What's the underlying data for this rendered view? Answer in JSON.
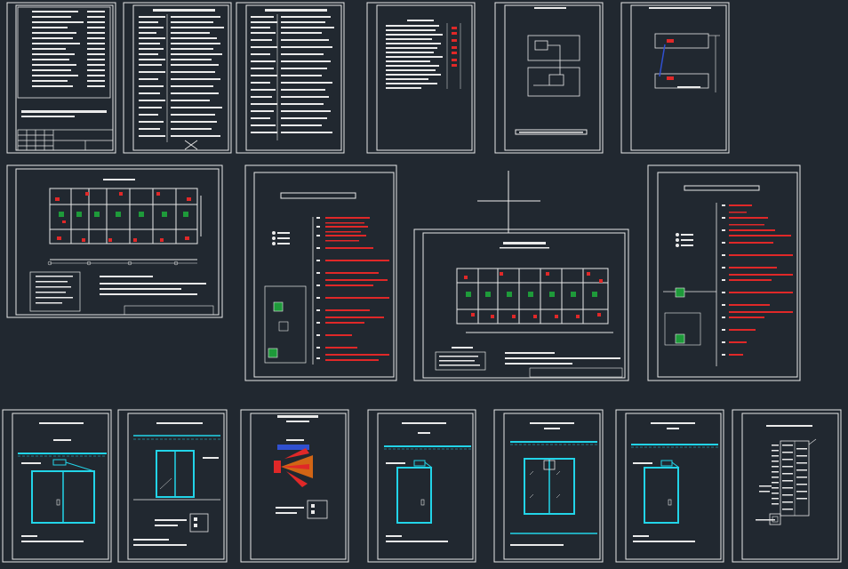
{
  "drawing_set": {
    "colors": {
      "background": "#212830",
      "sheet_frame": "#e8e8e8",
      "text_block": "#eaeaea",
      "alarm_red": "#e02828",
      "door_cyan": "#22d4e8",
      "detector_green": "#1e9a3a",
      "highlight_blue": "#3050d0",
      "highlight_orange": "#f07010"
    },
    "sheets": [
      {
        "id": "sheet-title-page",
        "kind": "text-table"
      },
      {
        "id": "sheet-spec-1",
        "kind": "text-table"
      },
      {
        "id": "sheet-spec-2",
        "kind": "text-table"
      },
      {
        "id": "sheet-equipment-list",
        "kind": "text-table-red"
      },
      {
        "id": "sheet-block-diagram",
        "kind": "block-diagram"
      },
      {
        "id": "sheet-connection-detail",
        "kind": "detail"
      },
      {
        "id": "sheet-floor-plan-1",
        "kind": "floor-plan"
      },
      {
        "id": "sheet-wiring-diagram-1",
        "kind": "wiring"
      },
      {
        "id": "sheet-floor-plan-2",
        "kind": "floor-plan"
      },
      {
        "id": "sheet-wiring-diagram-2",
        "kind": "wiring"
      },
      {
        "id": "sheet-door-detail-1",
        "kind": "door"
      },
      {
        "id": "sheet-window-detail",
        "kind": "door"
      },
      {
        "id": "sheet-detector-detail",
        "kind": "symbol"
      },
      {
        "id": "sheet-door-detail-2",
        "kind": "door"
      },
      {
        "id": "sheet-double-door-detail",
        "kind": "door"
      },
      {
        "id": "sheet-door-detail-3",
        "kind": "door"
      },
      {
        "id": "sheet-cabinet-detail",
        "kind": "panel"
      }
    ]
  }
}
